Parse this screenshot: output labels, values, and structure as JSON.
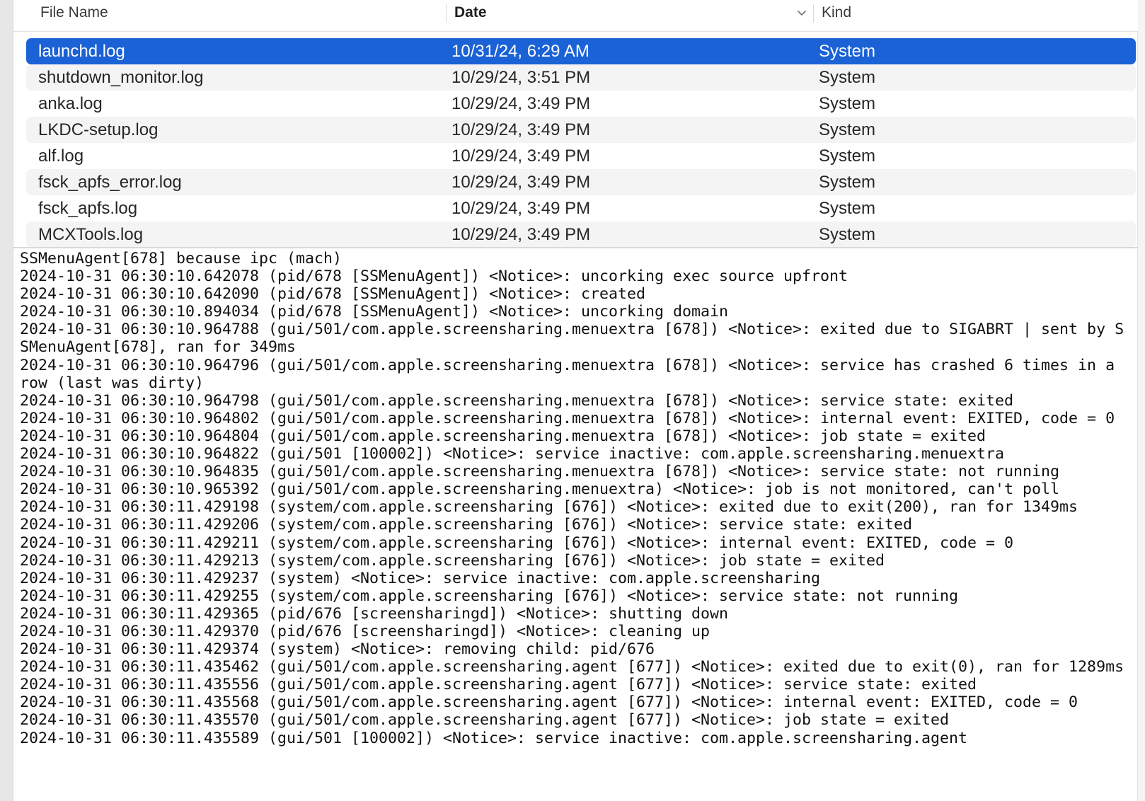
{
  "columns": {
    "name": "File Name",
    "date": "Date",
    "kind": "Kind",
    "sort_icon": "chevron-down-icon"
  },
  "files": [
    {
      "name": "launchd.log",
      "date": "10/31/24, 6:29 AM",
      "kind": "System",
      "selected": true
    },
    {
      "name": "shutdown_monitor.log",
      "date": "10/29/24, 3:51 PM",
      "kind": "System"
    },
    {
      "name": "anka.log",
      "date": "10/29/24, 3:49 PM",
      "kind": "System"
    },
    {
      "name": "LKDC-setup.log",
      "date": "10/29/24, 3:49 PM",
      "kind": "System"
    },
    {
      "name": "alf.log",
      "date": "10/29/24, 3:49 PM",
      "kind": "System"
    },
    {
      "name": "fsck_apfs_error.log",
      "date": "10/29/24, 3:49 PM",
      "kind": "System"
    },
    {
      "name": "fsck_apfs.log",
      "date": "10/29/24, 3:49 PM",
      "kind": "System"
    },
    {
      "name": "MCXTools.log",
      "date": "10/29/24, 3:49 PM",
      "kind": "System"
    }
  ],
  "log_lines": [
    "SSMenuAgent[678] because ipc (mach)",
    "2024-10-31 06:30:10.642078 (pid/678 [SSMenuAgent]) <Notice>: uncorking exec source upfront",
    "2024-10-31 06:30:10.642090 (pid/678 [SSMenuAgent]) <Notice>: created",
    "2024-10-31 06:30:10.894034 (pid/678 [SSMenuAgent]) <Notice>: uncorking domain",
    "2024-10-31 06:30:10.964788 (gui/501/com.apple.screensharing.menuextra [678]) <Notice>: exited due to SIGABRT | sent by SSMenuAgent[678], ran for 349ms",
    "2024-10-31 06:30:10.964796 (gui/501/com.apple.screensharing.menuextra [678]) <Notice>: service has crashed 6 times in a row (last was dirty)",
    "2024-10-31 06:30:10.964798 (gui/501/com.apple.screensharing.menuextra [678]) <Notice>: service state: exited",
    "2024-10-31 06:30:10.964802 (gui/501/com.apple.screensharing.menuextra [678]) <Notice>: internal event: EXITED, code = 0",
    "2024-10-31 06:30:10.964804 (gui/501/com.apple.screensharing.menuextra [678]) <Notice>: job state = exited",
    "2024-10-31 06:30:10.964822 (gui/501 [100002]) <Notice>: service inactive: com.apple.screensharing.menuextra",
    "2024-10-31 06:30:10.964835 (gui/501/com.apple.screensharing.menuextra [678]) <Notice>: service state: not running",
    "2024-10-31 06:30:10.965392 (gui/501/com.apple.screensharing.menuextra) <Notice>: job is not monitored, can't poll",
    "2024-10-31 06:30:11.429198 (system/com.apple.screensharing [676]) <Notice>: exited due to exit(200), ran for 1349ms",
    "2024-10-31 06:30:11.429206 (system/com.apple.screensharing [676]) <Notice>: service state: exited",
    "2024-10-31 06:30:11.429211 (system/com.apple.screensharing [676]) <Notice>: internal event: EXITED, code = 0",
    "2024-10-31 06:30:11.429213 (system/com.apple.screensharing [676]) <Notice>: job state = exited",
    "2024-10-31 06:30:11.429237 (system) <Notice>: service inactive: com.apple.screensharing",
    "2024-10-31 06:30:11.429255 (system/com.apple.screensharing [676]) <Notice>: service state: not running",
    "2024-10-31 06:30:11.429365 (pid/676 [screensharingd]) <Notice>: shutting down",
    "2024-10-31 06:30:11.429370 (pid/676 [screensharingd]) <Notice>: cleaning up",
    "2024-10-31 06:30:11.429374 (system) <Notice>: removing child: pid/676",
    "2024-10-31 06:30:11.435462 (gui/501/com.apple.screensharing.agent [677]) <Notice>: exited due to exit(0), ran for 1289ms",
    "2024-10-31 06:30:11.435556 (gui/501/com.apple.screensharing.agent [677]) <Notice>: service state: exited",
    "2024-10-31 06:30:11.435568 (gui/501/com.apple.screensharing.agent [677]) <Notice>: internal event: EXITED, code = 0",
    "2024-10-31 06:30:11.435570 (gui/501/com.apple.screensharing.agent [677]) <Notice>: job state = exited",
    "2024-10-31 06:30:11.435589 (gui/501 [100002]) <Notice>: service inactive: com.apple.screensharing.agent"
  ]
}
